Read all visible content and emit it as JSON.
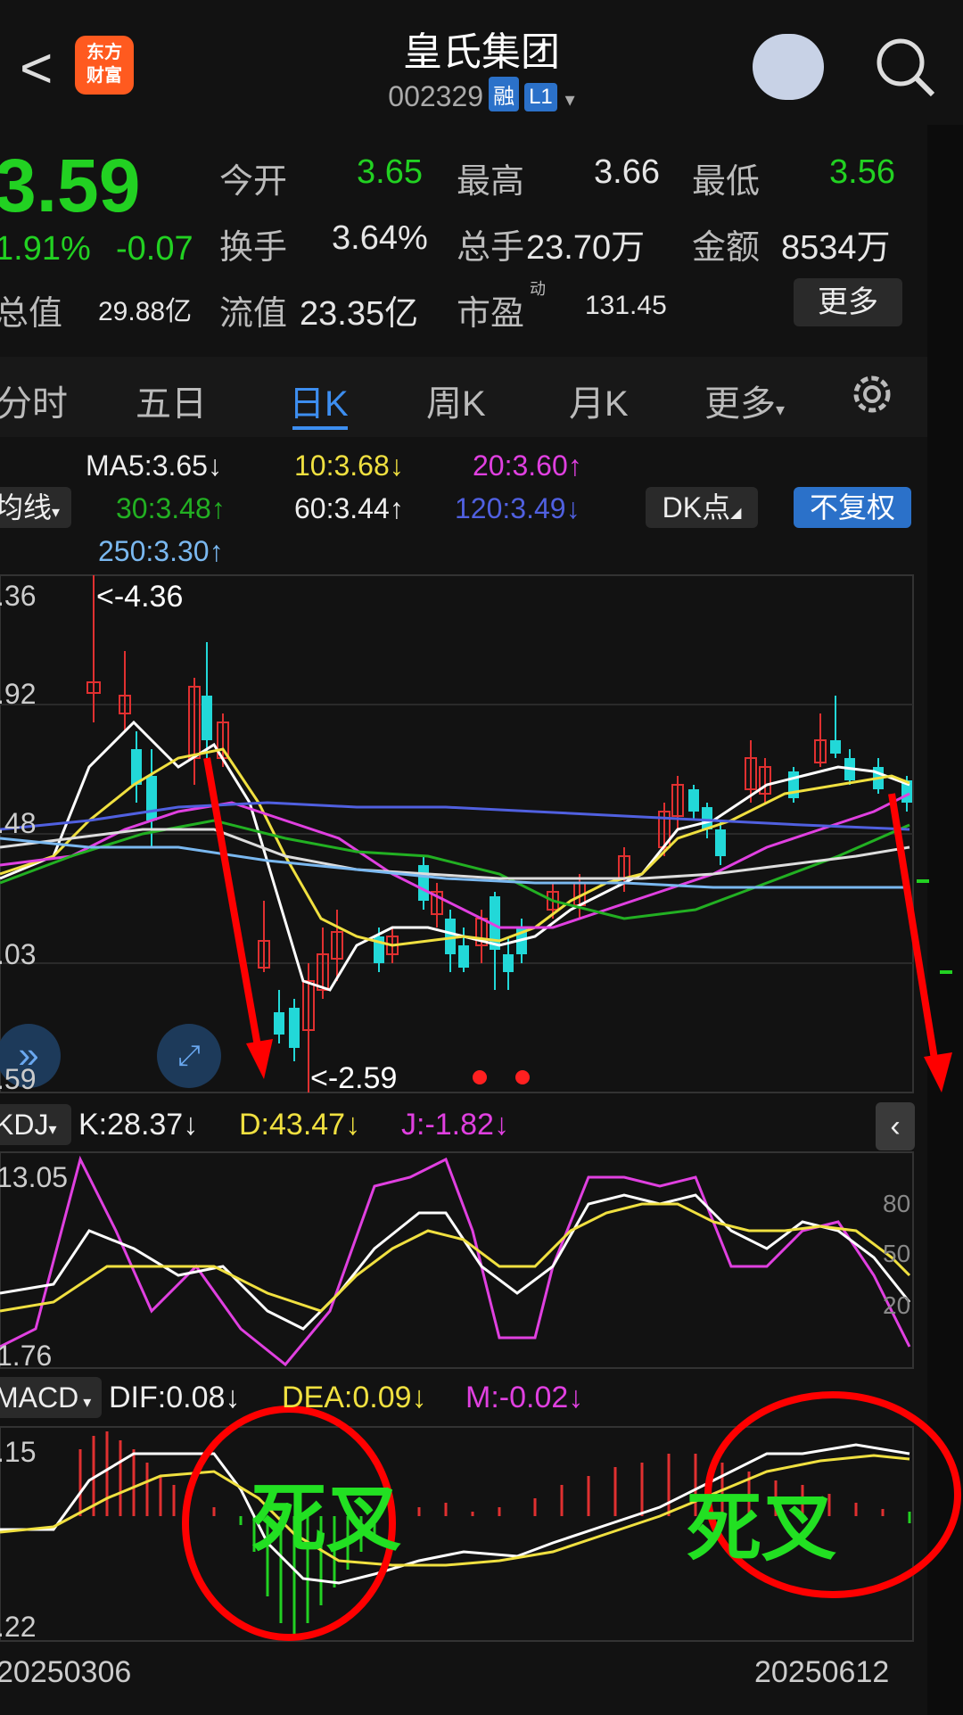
{
  "header": {
    "back": "<",
    "logo_line1": "东方",
    "logo_line2": "财富",
    "title": "皇氏集团",
    "code": "002329",
    "tag1": "融",
    "tag2": "L1"
  },
  "quote": {
    "price": "3.59",
    "pct": "1.91%",
    "chg": "-0.07",
    "open_label": "今开",
    "open": "3.65",
    "high_label": "最高",
    "high": "3.66",
    "low_label": "最低",
    "low": "3.56",
    "turnover_label": "换手",
    "turnover": "3.64%",
    "volume_label": "总手",
    "volume": "23.70万",
    "amount_label": "金额",
    "amount": "8534万",
    "mktcap_label": "总值",
    "mktcap": "29.88亿",
    "float_label": "流值",
    "float": "23.35亿",
    "pe_label": "市盈",
    "pe_sup": "动",
    "pe": "131.45",
    "more": "更多"
  },
  "tabs": [
    "分时",
    "五日",
    "日K",
    "周K",
    "月K",
    "更多"
  ],
  "ma": {
    "ma5": "MA5:3.65",
    "ma10": "10:3.68",
    "ma20": "20:3.60",
    "ma30": "30:3.48",
    "ma60": "60:3.44",
    "ma120": "120:3.49",
    "ma250": "250:3.30",
    "line_type": "均线",
    "dk": "DK点",
    "adj": "不复权"
  },
  "main_axis": {
    "p1": ".36",
    "p2": ".92",
    "p3": ".48",
    "p4": ".03",
    "p5": ".59",
    "hi": "<-4.36",
    "lo": "<-2.59"
  },
  "kdj": {
    "name": "KDJ",
    "k": "K:28.37",
    "d": "D:43.47",
    "j": "J:-1.82",
    "top": "13.05",
    "bot": "1.76",
    "l80": "80",
    "l50": "50",
    "l20": "20"
  },
  "macd": {
    "name": "MACD",
    "dif": "DIF:0.08",
    "dea": "DEA:0.09",
    "m": "M:-0.02",
    "top": ".15",
    "bot": ".22",
    "cross1": "死叉",
    "cross2": "死叉"
  },
  "dates": {
    "start": "20250306",
    "end": "20250612"
  },
  "colors": {
    "green": "#22d122",
    "red": "#e03030",
    "yellow": "#f0e040",
    "magenta": "#e040e0",
    "blue": "#3d8ef0"
  }
}
